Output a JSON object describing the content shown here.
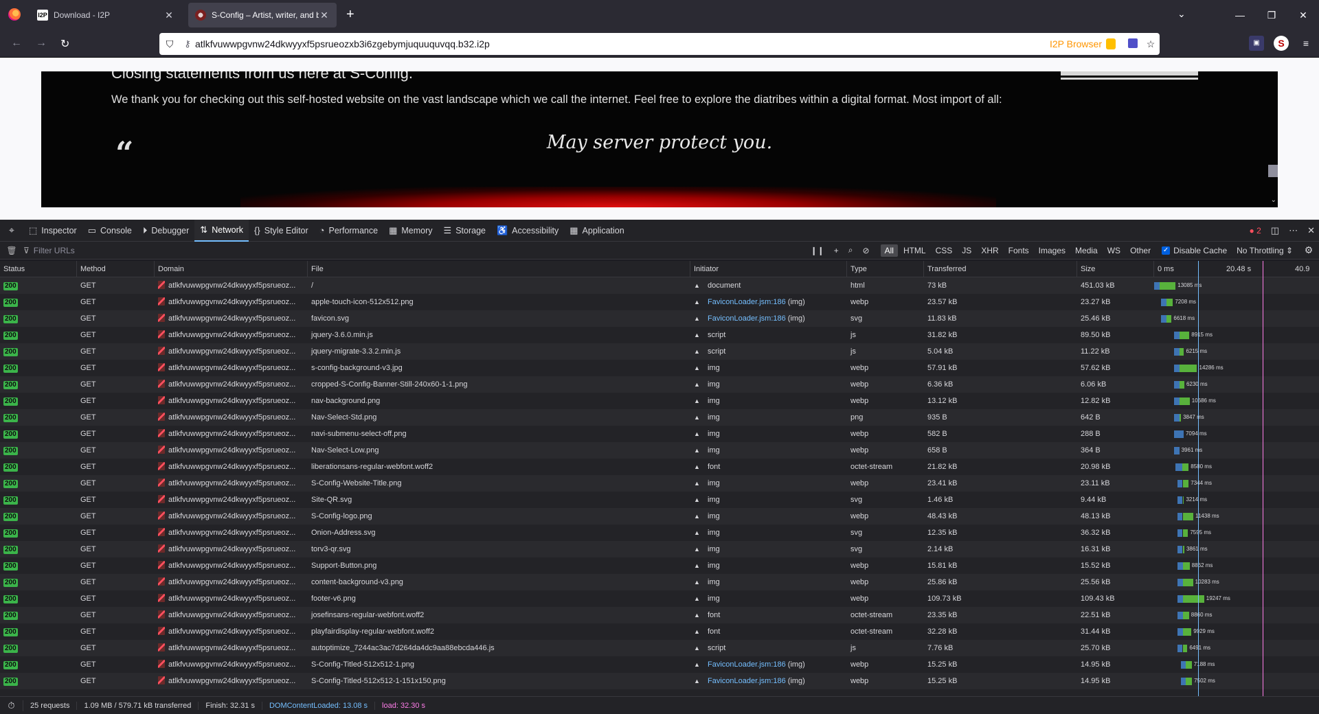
{
  "browser": {
    "tabs": [
      {
        "title": "Download - I2P",
        "favicon": "I2P"
      },
      {
        "title": "S-Config – Artist, writer, and bl…"
      }
    ],
    "url": "atlkfvuwwpgvnw24dkwyyxf5psrueozxb3i6zgebymjuquuquvqq.b32.i2p",
    "url_badge": "I2P Browser"
  },
  "page": {
    "heading": "Closing statements from us here at S-Config.",
    "body": "We thank you for checking out this self-hosted website on the vast landscape which we call the internet. Feel free to explore the diatribes within a digital format. Most import of all:",
    "quote_mark": "“",
    "quote": "May server protect you."
  },
  "devtools": {
    "tabs": [
      {
        "label": "Inspector",
        "icon": "inspector-icon",
        "glyph": "⬚"
      },
      {
        "label": "Console",
        "icon": "console-icon",
        "glyph": "▭"
      },
      {
        "label": "Debugger",
        "icon": "debugger-icon",
        "glyph": "⏵"
      },
      {
        "label": "Network",
        "icon": "network-icon",
        "glyph": "⇅",
        "active": true
      },
      {
        "label": "Style Editor",
        "icon": "style-editor-icon",
        "glyph": "{}"
      },
      {
        "label": "Performance",
        "icon": "performance-icon",
        "glyph": "◔"
      },
      {
        "label": "Memory",
        "icon": "memory-icon",
        "glyph": "▦"
      },
      {
        "label": "Storage",
        "icon": "storage-icon",
        "glyph": "☰"
      },
      {
        "label": "Accessibility",
        "icon": "accessibility-icon",
        "glyph": "♿"
      },
      {
        "label": "Application",
        "icon": "application-icon",
        "glyph": "▦"
      }
    ],
    "error_count": "2",
    "filter_placeholder": "Filter URLs",
    "type_filters": [
      "All",
      "HTML",
      "CSS",
      "JS",
      "XHR",
      "Fonts",
      "Images",
      "Media",
      "WS",
      "Other"
    ],
    "disable_cache": "Disable Cache",
    "throttling": "No Throttling ⇕",
    "columns": [
      "Status",
      "Method",
      "Domain",
      "File",
      "Initiator",
      "Type",
      "Transferred",
      "Size"
    ],
    "timeline_ticks": [
      "0 ms",
      "20.48 s",
      "40.9"
    ],
    "requests": [
      {
        "status": "200",
        "method": "GET",
        "domain": "atlkfvuwwpgvnw24dkwyyxf5psrueoz...",
        "file": "/",
        "initiator": "document",
        "initiator_link": false,
        "type": "html",
        "transferred": "73 kB",
        "size": "451.03 kB",
        "start": 0,
        "wait": 1.6,
        "recv": 4.8,
        "ms": "13085 ms"
      },
      {
        "status": "200",
        "method": "GET",
        "domain": "atlkfvuwwpgvnw24dkwyyxf5psrueoz...",
        "file": "apple-touch-icon-512x512.png",
        "initiator": "FaviconLoader.jsm:186",
        "initiator_suffix": " (img)",
        "initiator_link": true,
        "type": "webp",
        "transferred": "23.57 kB",
        "size": "23.27 kB",
        "start": 2.1,
        "wait": 1.5,
        "recv": 2.0,
        "ms": "7208 ms"
      },
      {
        "status": "200",
        "method": "GET",
        "domain": "atlkfvuwwpgvnw24dkwyyxf5psrueoz...",
        "file": "favicon.svg",
        "initiator": "FaviconLoader.jsm:186",
        "initiator_suffix": " (img)",
        "initiator_link": true,
        "type": "svg",
        "transferred": "11.83 kB",
        "size": "25.46 kB",
        "start": 2.1,
        "wait": 1.5,
        "recv": 1.6,
        "ms": "6618 ms"
      },
      {
        "status": "200",
        "method": "GET",
        "domain": "atlkfvuwwpgvnw24dkwyyxf5psrueoz...",
        "file": "jquery-3.6.0.min.js",
        "initiator": "script",
        "initiator_link": false,
        "type": "js",
        "transferred": "31.82 kB",
        "size": "89.50 kB",
        "start": 6.0,
        "wait": 1.5,
        "recv": 3.0,
        "ms": "8915 ms"
      },
      {
        "status": "200",
        "method": "GET",
        "domain": "atlkfvuwwpgvnw24dkwyyxf5psrueoz...",
        "file": "jquery-migrate-3.3.2.min.js",
        "initiator": "script",
        "initiator_link": false,
        "type": "js",
        "transferred": "5.04 kB",
        "size": "11.22 kB",
        "start": 6.0,
        "wait": 1.5,
        "recv": 1.4,
        "ms": "6215 ms"
      },
      {
        "status": "200",
        "method": "GET",
        "domain": "atlkfvuwwpgvnw24dkwyyxf5psrueoz...",
        "file": "s-config-background-v3.jpg",
        "initiator": "img",
        "initiator_link": false,
        "type": "webp",
        "transferred": "57.91 kB",
        "size": "57.62 kB",
        "start": 6.0,
        "wait": 1.5,
        "recv": 5.3,
        "ms": "14286 ms"
      },
      {
        "status": "200",
        "method": "GET",
        "domain": "atlkfvuwwpgvnw24dkwyyxf5psrueoz...",
        "file": "cropped-S-Config-Banner-Still-240x60-1-1.png",
        "initiator": "img",
        "initiator_link": false,
        "type": "webp",
        "transferred": "6.36 kB",
        "size": "6.06 kB",
        "start": 6.0,
        "wait": 1.5,
        "recv": 1.5,
        "ms": "6230 ms"
      },
      {
        "status": "200",
        "method": "GET",
        "domain": "atlkfvuwwpgvnw24dkwyyxf5psrueoz...",
        "file": "nav-background.png",
        "initiator": "img",
        "initiator_link": false,
        "type": "webp",
        "transferred": "13.12 kB",
        "size": "12.82 kB",
        "start": 6.0,
        "wait": 1.6,
        "recv": 3.0,
        "ms": "10686 ms"
      },
      {
        "status": "200",
        "method": "GET",
        "domain": "atlkfvuwwpgvnw24dkwyyxf5psrueoz...",
        "file": "Nav-Select-Std.png",
        "initiator": "img",
        "initiator_link": false,
        "type": "png",
        "transferred": "935 B",
        "size": "642 B",
        "start": 6.0,
        "wait": 1.5,
        "recv": 0.5,
        "ms": "3847 ms"
      },
      {
        "status": "200",
        "method": "GET",
        "domain": "atlkfvuwwpgvnw24dkwyyxf5psrueoz...",
        "file": "navi-submenu-select-off.png",
        "initiator": "img",
        "initiator_link": false,
        "type": "webp",
        "transferred": "582 B",
        "size": "288 B",
        "start": 6.0,
        "wait": 2.8,
        "recv": 0.0,
        "ms": "7094 ms"
      },
      {
        "status": "200",
        "method": "GET",
        "domain": "atlkfvuwwpgvnw24dkwyyxf5psrueoz...",
        "file": "Nav-Select-Low.png",
        "initiator": "img",
        "initiator_link": false,
        "type": "webp",
        "transferred": "658 B",
        "size": "364 B",
        "start": 6.0,
        "wait": 1.5,
        "recv": 0.0,
        "ms": "3961 ms"
      },
      {
        "status": "200",
        "method": "GET",
        "domain": "atlkfvuwwpgvnw24dkwyyxf5psrueoz...",
        "file": "liberationsans-regular-webfont.woff2",
        "initiator": "font",
        "initiator_link": false,
        "type": "octet-stream",
        "transferred": "21.82 kB",
        "size": "20.98 kB",
        "start": 6.3,
        "wait": 2.0,
        "recv": 2.0,
        "ms": "8580 ms"
      },
      {
        "status": "200",
        "method": "GET",
        "domain": "atlkfvuwwpgvnw24dkwyyxf5psrueoz...",
        "file": "S-Config-Website-Title.png",
        "initiator": "img",
        "initiator_link": false,
        "type": "webp",
        "transferred": "23.41 kB",
        "size": "23.11 kB",
        "start": 7.0,
        "wait": 1.5,
        "recv": 1.8,
        "ms": "7344 ms"
      },
      {
        "status": "200",
        "method": "GET",
        "domain": "atlkfvuwwpgvnw24dkwyyxf5psrueoz...",
        "file": "Site-QR.svg",
        "initiator": "img",
        "initiator_link": false,
        "type": "svg",
        "transferred": "1.46 kB",
        "size": "9.44 kB",
        "start": 7.0,
        "wait": 1.5,
        "recv": 0.4,
        "ms": "3214 ms"
      },
      {
        "status": "200",
        "method": "GET",
        "domain": "atlkfvuwwpgvnw24dkwyyxf5psrueoz...",
        "file": "S-Config-logo.png",
        "initiator": "img",
        "initiator_link": false,
        "type": "webp",
        "transferred": "48.43 kB",
        "size": "48.13 kB",
        "start": 7.0,
        "wait": 1.5,
        "recv": 3.2,
        "ms": "11438 ms"
      },
      {
        "status": "200",
        "method": "GET",
        "domain": "atlkfvuwwpgvnw24dkwyyxf5psrueoz...",
        "file": "Onion-Address.svg",
        "initiator": "img",
        "initiator_link": false,
        "type": "svg",
        "transferred": "12.35 kB",
        "size": "36.32 kB",
        "start": 7.0,
        "wait": 1.5,
        "recv": 1.6,
        "ms": "7595 ms"
      },
      {
        "status": "200",
        "method": "GET",
        "domain": "atlkfvuwwpgvnw24dkwyyxf5psrueoz...",
        "file": "torv3-qr.svg",
        "initiator": "img",
        "initiator_link": false,
        "type": "svg",
        "transferred": "2.14 kB",
        "size": "16.31 kB",
        "start": 7.0,
        "wait": 1.5,
        "recv": 0.5,
        "ms": "3861 ms"
      },
      {
        "status": "200",
        "method": "GET",
        "domain": "atlkfvuwwpgvnw24dkwyyxf5psrueoz...",
        "file": "Support-Button.png",
        "initiator": "img",
        "initiator_link": false,
        "type": "webp",
        "transferred": "15.81 kB",
        "size": "15.52 kB",
        "start": 7.0,
        "wait": 1.6,
        "recv": 2.0,
        "ms": "8862 ms"
      },
      {
        "status": "200",
        "method": "GET",
        "domain": "atlkfvuwwpgvnw24dkwyyxf5psrueoz...",
        "file": "content-background-v3.png",
        "initiator": "img",
        "initiator_link": false,
        "type": "webp",
        "transferred": "25.86 kB",
        "size": "25.56 kB",
        "start": 7.0,
        "wait": 1.6,
        "recv": 3.0,
        "ms": "10283 ms"
      },
      {
        "status": "200",
        "method": "GET",
        "domain": "atlkfvuwwpgvnw24dkwyyxf5psrueoz...",
        "file": "footer-v6.png",
        "initiator": "img",
        "initiator_link": false,
        "type": "webp",
        "transferred": "109.73 kB",
        "size": "109.43 kB",
        "start": 7.0,
        "wait": 1.6,
        "recv": 6.3,
        "ms": "19247 ms"
      },
      {
        "status": "200",
        "method": "GET",
        "domain": "atlkfvuwwpgvnw24dkwyyxf5psrueoz...",
        "file": "josefinsans-regular-webfont.woff2",
        "initiator": "font",
        "initiator_link": false,
        "type": "octet-stream",
        "transferred": "23.35 kB",
        "size": "22.51 kB",
        "start": 7.0,
        "wait": 1.6,
        "recv": 1.8,
        "ms": "8860 ms"
      },
      {
        "status": "200",
        "method": "GET",
        "domain": "atlkfvuwwpgvnw24dkwyyxf5psrueoz...",
        "file": "playfairdisplay-regular-webfont.woff2",
        "initiator": "font",
        "initiator_link": false,
        "type": "octet-stream",
        "transferred": "32.28 kB",
        "size": "31.44 kB",
        "start": 7.0,
        "wait": 1.6,
        "recv": 2.5,
        "ms": "9929 ms"
      },
      {
        "status": "200",
        "method": "GET",
        "domain": "atlkfvuwwpgvnw24dkwyyxf5psrueoz...",
        "file": "autoptimize_7244ac3ac7d264da4dc9aa88ebcda446.js",
        "initiator": "script",
        "initiator_link": false,
        "type": "js",
        "transferred": "7.76 kB",
        "size": "25.70 kB",
        "start": 7.0,
        "wait": 1.5,
        "recv": 1.4,
        "ms": "6491 ms"
      },
      {
        "status": "200",
        "method": "GET",
        "domain": "atlkfvuwwpgvnw24dkwyyxf5psrueoz...",
        "file": "S-Config-Titled-512x512-1.png",
        "initiator": "FaviconLoader.jsm:186",
        "initiator_suffix": " (img)",
        "initiator_link": true,
        "type": "webp",
        "transferred": "15.25 kB",
        "size": "14.95 kB",
        "start": 8.0,
        "wait": 1.5,
        "recv": 1.7,
        "ms": "7188 ms"
      },
      {
        "status": "200",
        "method": "GET",
        "domain": "atlkfvuwwpgvnw24dkwyyxf5psrueoz...",
        "file": "S-Config-Titled-512x512-1-151x150.png",
        "initiator": "FaviconLoader.jsm:186",
        "initiator_suffix": " (img)",
        "initiator_link": true,
        "type": "webp",
        "transferred": "15.25 kB",
        "size": "14.95 kB",
        "start": 8.0,
        "wait": 1.5,
        "recv": 1.8,
        "ms": "7502 ms"
      }
    ],
    "summary": {
      "requests": "25 requests",
      "transferred": "1.09 MB / 579.71 kB transferred",
      "finish": "Finish: 32.31 s",
      "dcl": "DOMContentLoaded: 13.08 s",
      "load": "load: 32.30 s"
    }
  }
}
